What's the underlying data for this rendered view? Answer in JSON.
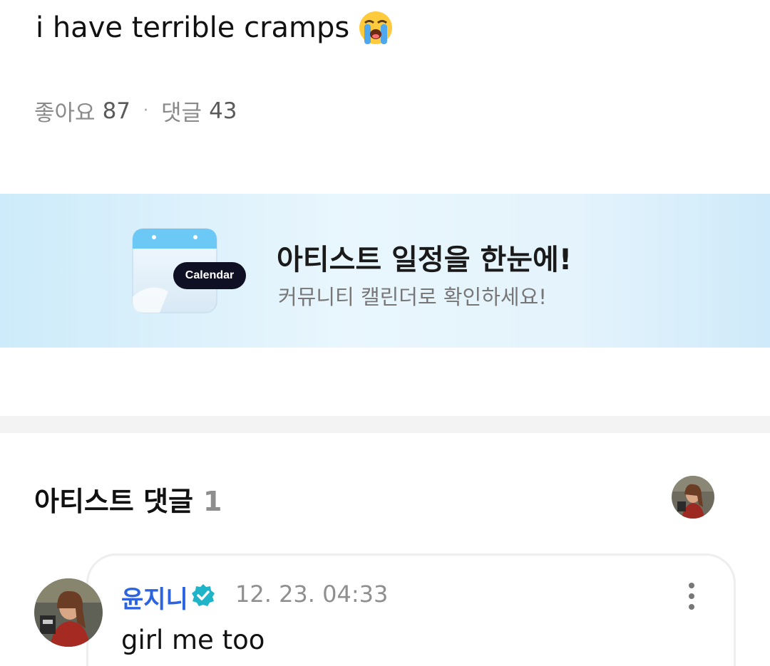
{
  "post": {
    "text": "i have terrible cramps",
    "emoji_icon": "loudly-crying-face-emoji"
  },
  "stats": {
    "likes_label": "좋아요",
    "likes_count": "87",
    "separator": "·",
    "comments_label": "댓글",
    "comments_count": "43"
  },
  "banner": {
    "icon": "calendar-icon",
    "pill_label": "Calendar",
    "title": "아티스트 일정을 한눈에!",
    "subtitle": "커뮤니티 캘린더로 확인하세요!",
    "colors": {
      "background": "#dff1fb",
      "pill": "#101025"
    }
  },
  "artist_comments": {
    "title": "아티스트 댓글",
    "count": "1",
    "avatar_icon": "artist-avatar"
  },
  "comment": {
    "author": "윤지니",
    "verified_icon": "verified-badge-icon",
    "timestamp": "12. 23. 04:33",
    "body": "girl me too",
    "more_icon": "more-vertical-icon",
    "colors": {
      "author": "#2b63e0",
      "badge": "#1fb4c8"
    }
  }
}
